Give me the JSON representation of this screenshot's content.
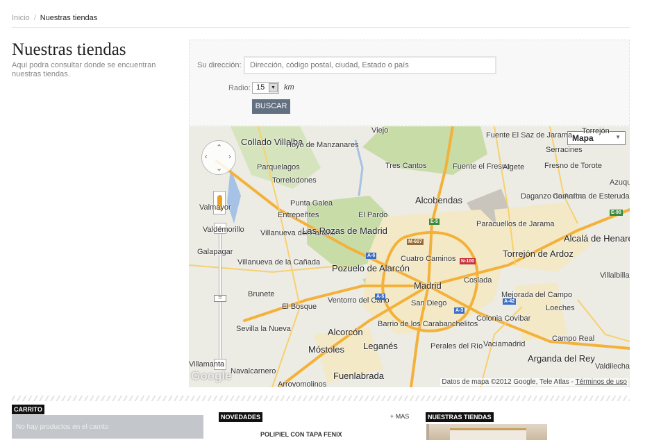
{
  "breadcrumb": {
    "home": "Inicio",
    "current": "Nuestras tiendas"
  },
  "page": {
    "title": "Nuestras tiendas",
    "subtitle": "Aqui podra consultar donde se encuentran nuestras tiendas."
  },
  "search": {
    "address_label": "Su dirección:",
    "address_placeholder": "Dirección, código postal, ciudad, Estado o país",
    "radius_label": "Radio:",
    "radius_value": "15",
    "radius_unit": "km",
    "button_label": "BUSCAR"
  },
  "map": {
    "type_label": "Mapa",
    "logo": "Google",
    "attribution": "Datos de mapa ©2012 Google, Tele Atlas -",
    "terms_link": "Términos de uso",
    "colors": {
      "water": "#a6c2e6",
      "park": "#c7dca7",
      "urban": "#f3e9c6",
      "highway": "#f4b13a",
      "land": "#ecebe4"
    },
    "places": [
      "Viejo",
      "Fuente El Saz de Jarama",
      "Torrejón",
      "Collado Villalba",
      "Hoyo de Manzanares",
      "Serracines",
      "Parquelagos",
      "Tres Cantos",
      "Fuente el Fresno",
      "Algete",
      "Fresno de Torote",
      "Torrelodones",
      "Azuqueca de Henares",
      "Punta Galea",
      "Alcobendas",
      "Daganzo de Arriba",
      "Camarma de Esterudas",
      "Valmayor",
      "Entrepeñtes",
      "El Pardo",
      "Paracuellos de Jarama",
      "Valdemorillo",
      "Villanueva del Pardillo",
      "Las Rozas de Madrid",
      "Alcalá de Henares",
      "Galapagar",
      "Cuatro Caminos",
      "Torrejón de Ardoz",
      "Villanueva de la Cañada",
      "Pozuelo de Alarcón",
      "Madrid",
      "Coslada",
      "Villalbilla",
      "Brunete",
      "El Bosque",
      "Ventorro del Cano",
      "San Diego",
      "Mejorada del Campo",
      "Loeches",
      "Sevilla la Nueva",
      "Alcorcón",
      "Barrio de los Carabanchelitos",
      "Colonia Covibar",
      "Campo Real",
      "Móstoles",
      "Leganés",
      "Perales del Río",
      "Vaciamadrid",
      "Arganda del Rey",
      "Valdilecha",
      "Villamanta",
      "Navalcarnero",
      "Arroyomolinos",
      "Fuenlabrada"
    ],
    "road_shields": [
      "A-6",
      "A-5",
      "A-3",
      "A-42",
      "M-607",
      "N-100",
      "E-5",
      "E-90"
    ]
  },
  "footer": {
    "cart_heading": "CARRITO",
    "cart_empty": "No hay productos en el carrito",
    "news_heading": "NOVEDADES",
    "more_link": "+ MAS",
    "product_name": "POLIPIEL CON TAPA FENIX",
    "stores_heading": "NUESTRAS TIENDAS"
  }
}
